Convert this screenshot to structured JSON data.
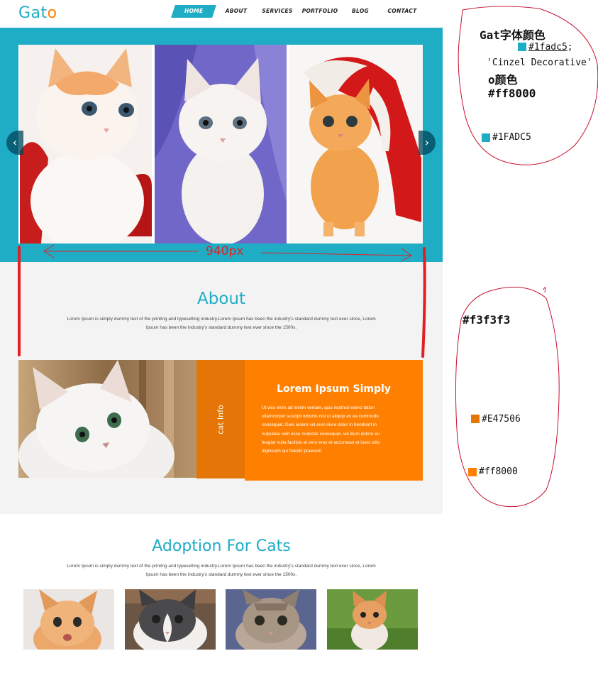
{
  "brand": {
    "part1": "Gat",
    "part2": "o"
  },
  "nav": {
    "items": [
      {
        "label": "HOME",
        "active": true
      },
      {
        "label": "ABOUT",
        "active": false
      },
      {
        "label": "SERVICES",
        "active": false
      },
      {
        "label": "PORTFOLIO",
        "active": false
      },
      {
        "label": "BLOG",
        "active": false
      },
      {
        "label": "CONTACT",
        "active": false
      }
    ]
  },
  "slider": {
    "prev_icon": "chevron-left-icon",
    "next_icon": "chevron-right-icon",
    "prev_glyph": "‹",
    "next_glyph": "›"
  },
  "about": {
    "title": "About",
    "text_line1": "Lorem Ipsum is simply dummy text of the printing and typesetting industry.Lorem Ipsum has been the industry's standard dummy text ever since, Lorem",
    "text_line2": "Ipsum has been the industry's standard dummy text ever since the 1500s."
  },
  "info": {
    "tab_label": "cat Info",
    "title": "Lorem Ipsum Simply",
    "lines": [
      "Ut wisi enim ad minim veniam, quis nostrud exerci tation",
      "ullamcorper suscipit lobortis nisl ut aliquip ex ea commodo",
      "consequat. Duis autem vel eum iriure dolor in hendrerit in",
      "vulputate velit esse molestie consequat, vel illum dolore eu",
      "feugiat nulla facilisis at vero eros et accumsan et iusto odio",
      "dignissim qui blandit praesent"
    ]
  },
  "adoption": {
    "title": "Adoption For Cats",
    "text_line1": "Lorem Ipsum is simply dummy text of the printing and typesetting industry.Lorem Ipsum has been the industry's standard dummy text ever since, Lorem",
    "text_line2": "Ipsum has been the industry's standard dummy text ever since the 1500s."
  },
  "annotations": {
    "width_label": "940px",
    "gat_color_label": "Gat字体颜色",
    "gat_color_value": "#1fadc5",
    "gat_color_suffix": ";",
    "font_name": "'Cinzel Decorative'",
    "o_color_label": "o颜色",
    "o_color_value": "#ff8000",
    "swatch_1fadc5_upper": "#1FADC5",
    "bg_color": "#f3f3f3",
    "swatch_e47506": "#E47506",
    "swatch_ff8000": "#ff8000"
  },
  "colors": {
    "accent": "#1fadc5",
    "orange": "#ff8000",
    "dark_orange": "#e47506",
    "section_bg": "#f3f3f3",
    "annotation_red": "#d9262c"
  }
}
